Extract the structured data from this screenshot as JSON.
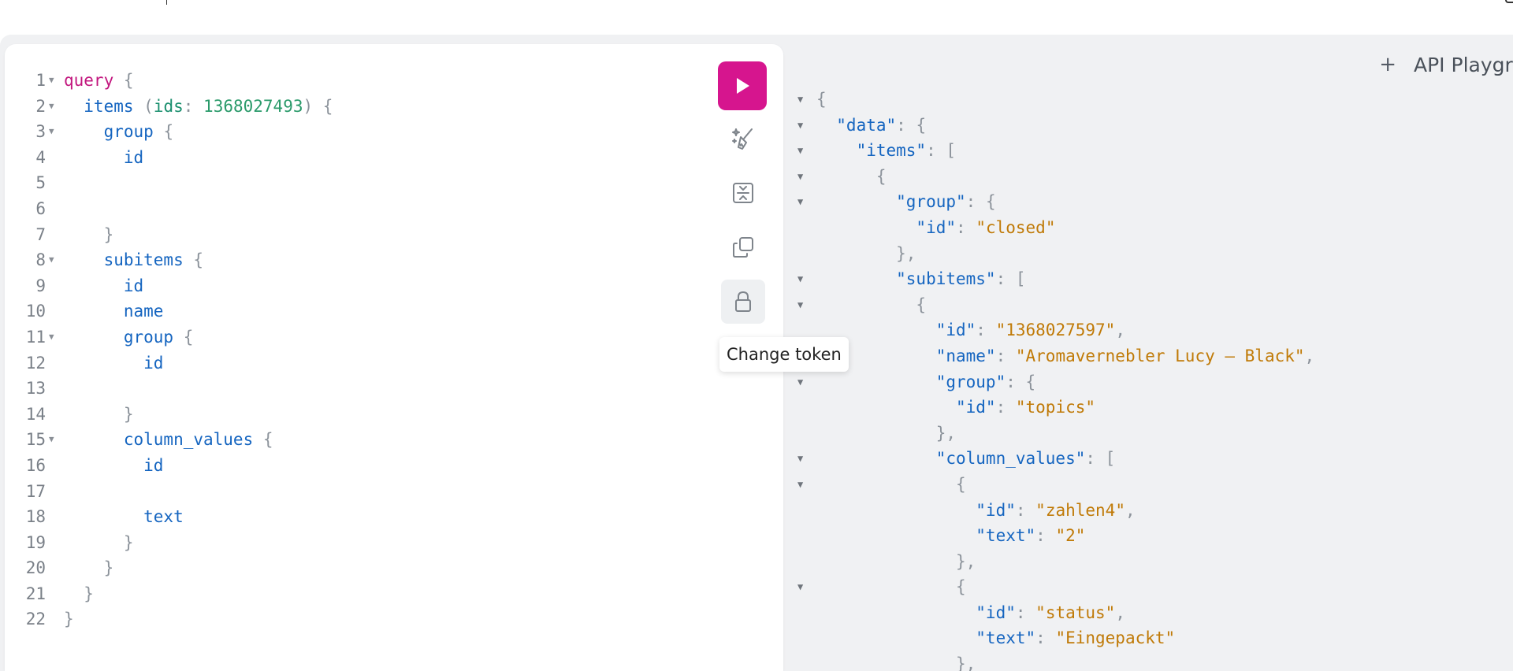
{
  "editor": {
    "lines": [
      {
        "n": "1",
        "fold": true,
        "parts": [
          {
            "t": "query",
            "c": "kw"
          },
          {
            "t": " {",
            "c": "pu"
          }
        ]
      },
      {
        "n": "2",
        "fold": true,
        "parts": [
          {
            "t": "  items",
            "c": "fld"
          },
          {
            "t": " (",
            "c": "pu"
          },
          {
            "t": "ids",
            "c": "arg"
          },
          {
            "t": ": ",
            "c": "pu"
          },
          {
            "t": "1368027493",
            "c": "num"
          },
          {
            "t": ") {",
            "c": "pu"
          }
        ]
      },
      {
        "n": "3",
        "fold": true,
        "parts": [
          {
            "t": "    group",
            "c": "fld"
          },
          {
            "t": " {",
            "c": "pu"
          }
        ]
      },
      {
        "n": "4",
        "fold": false,
        "parts": [
          {
            "t": "      id",
            "c": "fld"
          }
        ]
      },
      {
        "n": "5",
        "fold": false,
        "parts": []
      },
      {
        "n": "6",
        "fold": false,
        "parts": []
      },
      {
        "n": "7",
        "fold": false,
        "parts": [
          {
            "t": "    }",
            "c": "pu"
          }
        ]
      },
      {
        "n": "8",
        "fold": true,
        "parts": [
          {
            "t": "    subitems",
            "c": "fld"
          },
          {
            "t": " {",
            "c": "pu"
          }
        ]
      },
      {
        "n": "9",
        "fold": false,
        "parts": [
          {
            "t": "      id",
            "c": "fld"
          }
        ]
      },
      {
        "n": "10",
        "fold": false,
        "parts": [
          {
            "t": "      name",
            "c": "fld"
          }
        ]
      },
      {
        "n": "11",
        "fold": true,
        "parts": [
          {
            "t": "      group",
            "c": "fld"
          },
          {
            "t": " {",
            "c": "pu"
          }
        ]
      },
      {
        "n": "12",
        "fold": false,
        "parts": [
          {
            "t": "        id",
            "c": "fld"
          }
        ]
      },
      {
        "n": "13",
        "fold": false,
        "parts": []
      },
      {
        "n": "14",
        "fold": false,
        "parts": [
          {
            "t": "      }",
            "c": "pu"
          }
        ]
      },
      {
        "n": "15",
        "fold": true,
        "parts": [
          {
            "t": "      column_values",
            "c": "fld"
          },
          {
            "t": " {",
            "c": "pu"
          }
        ]
      },
      {
        "n": "16",
        "fold": false,
        "parts": [
          {
            "t": "        id",
            "c": "fld"
          }
        ]
      },
      {
        "n": "17",
        "fold": false,
        "parts": []
      },
      {
        "n": "18",
        "fold": false,
        "parts": [
          {
            "t": "        text",
            "c": "fld"
          }
        ]
      },
      {
        "n": "19",
        "fold": false,
        "parts": [
          {
            "t": "      }",
            "c": "pu"
          }
        ]
      },
      {
        "n": "20",
        "fold": false,
        "parts": [
          {
            "t": "    }",
            "c": "pu"
          }
        ]
      },
      {
        "n": "21",
        "fold": false,
        "parts": [
          {
            "t": "  }",
            "c": "pu"
          }
        ]
      },
      {
        "n": "22",
        "fold": false,
        "parts": [
          {
            "t": "}",
            "c": "pu"
          }
        ]
      }
    ]
  },
  "toolbar": {
    "run_icon": "play-icon",
    "prettify_icon": "sparkle-broom-icon",
    "merge_icon": "merge-fragments-icon",
    "copy_icon": "copy-icon",
    "token_icon": "lock-icon",
    "tooltip": "Change token",
    "accent": "#d6158e"
  },
  "result_header": {
    "plus_label": "+",
    "title": "API Playground"
  },
  "result": {
    "lines": [
      {
        "fold": true,
        "parts": [
          {
            "t": "{",
            "c": "jpu"
          }
        ]
      },
      {
        "fold": true,
        "parts": [
          {
            "t": "  \"data\"",
            "c": "jkey"
          },
          {
            "t": ": {",
            "c": "jpu"
          }
        ]
      },
      {
        "fold": true,
        "parts": [
          {
            "t": "    \"items\"",
            "c": "jkey"
          },
          {
            "t": ": [",
            "c": "jpu"
          }
        ]
      },
      {
        "fold": true,
        "parts": [
          {
            "t": "      {",
            "c": "jpu"
          }
        ]
      },
      {
        "fold": true,
        "parts": [
          {
            "t": "        \"group\"",
            "c": "jkey"
          },
          {
            "t": ": {",
            "c": "jpu"
          }
        ]
      },
      {
        "fold": false,
        "parts": [
          {
            "t": "          \"id\"",
            "c": "jkey"
          },
          {
            "t": ": ",
            "c": "jpu"
          },
          {
            "t": "\"closed\"",
            "c": "jstr"
          }
        ]
      },
      {
        "fold": false,
        "parts": [
          {
            "t": "        },",
            "c": "jpu"
          }
        ]
      },
      {
        "fold": true,
        "parts": [
          {
            "t": "        \"subitems\"",
            "c": "jkey"
          },
          {
            "t": ": [",
            "c": "jpu"
          }
        ]
      },
      {
        "fold": true,
        "parts": [
          {
            "t": "          {",
            "c": "jpu"
          }
        ]
      },
      {
        "fold": false,
        "parts": [
          {
            "t": "            \"id\"",
            "c": "jkey"
          },
          {
            "t": ": ",
            "c": "jpu"
          },
          {
            "t": "\"1368027597\"",
            "c": "jstr"
          },
          {
            "t": ",",
            "c": "jpu"
          }
        ]
      },
      {
        "fold": false,
        "parts": [
          {
            "t": "            \"name\"",
            "c": "jkey"
          },
          {
            "t": ": ",
            "c": "jpu"
          },
          {
            "t": "\"Aromavernebler Lucy – Black\"",
            "c": "jstr"
          },
          {
            "t": ",",
            "c": "jpu"
          }
        ]
      },
      {
        "fold": true,
        "parts": [
          {
            "t": "            \"group\"",
            "c": "jkey"
          },
          {
            "t": ": {",
            "c": "jpu"
          }
        ]
      },
      {
        "fold": false,
        "parts": [
          {
            "t": "              \"id\"",
            "c": "jkey"
          },
          {
            "t": ": ",
            "c": "jpu"
          },
          {
            "t": "\"topics\"",
            "c": "jstr"
          }
        ]
      },
      {
        "fold": false,
        "parts": [
          {
            "t": "            },",
            "c": "jpu"
          }
        ]
      },
      {
        "fold": true,
        "parts": [
          {
            "t": "            \"column_values\"",
            "c": "jkey"
          },
          {
            "t": ": [",
            "c": "jpu"
          }
        ]
      },
      {
        "fold": true,
        "parts": [
          {
            "t": "              {",
            "c": "jpu"
          }
        ]
      },
      {
        "fold": false,
        "parts": [
          {
            "t": "                \"id\"",
            "c": "jkey"
          },
          {
            "t": ": ",
            "c": "jpu"
          },
          {
            "t": "\"zahlen4\"",
            "c": "jstr"
          },
          {
            "t": ",",
            "c": "jpu"
          }
        ]
      },
      {
        "fold": false,
        "parts": [
          {
            "t": "                \"text\"",
            "c": "jkey"
          },
          {
            "t": ": ",
            "c": "jpu"
          },
          {
            "t": "\"2\"",
            "c": "jstr"
          }
        ]
      },
      {
        "fold": false,
        "parts": [
          {
            "t": "              },",
            "c": "jpu"
          }
        ]
      },
      {
        "fold": true,
        "parts": [
          {
            "t": "              {",
            "c": "jpu"
          }
        ]
      },
      {
        "fold": false,
        "parts": [
          {
            "t": "                \"id\"",
            "c": "jkey"
          },
          {
            "t": ": ",
            "c": "jpu"
          },
          {
            "t": "\"status\"",
            "c": "jstr"
          },
          {
            "t": ",",
            "c": "jpu"
          }
        ]
      },
      {
        "fold": false,
        "parts": [
          {
            "t": "                \"text\"",
            "c": "jkey"
          },
          {
            "t": ": ",
            "c": "jpu"
          },
          {
            "t": "\"Eingepackt\"",
            "c": "jstr"
          }
        ]
      },
      {
        "fold": false,
        "parts": [
          {
            "t": "              },",
            "c": "jpu"
          }
        ]
      }
    ]
  }
}
